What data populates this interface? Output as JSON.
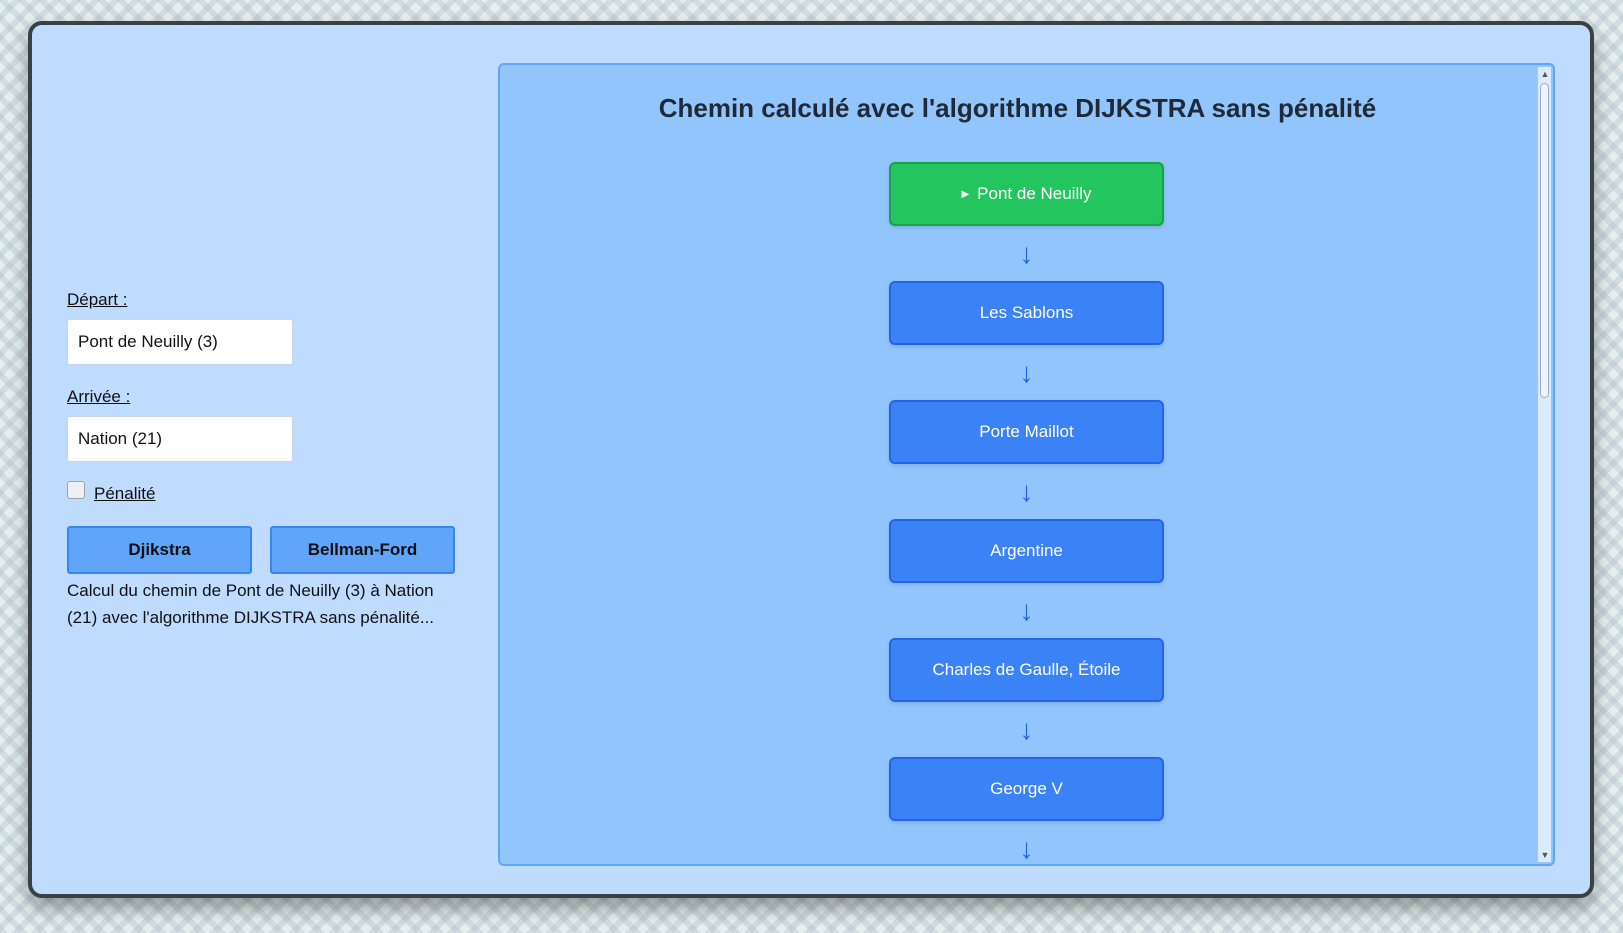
{
  "form": {
    "departure_label": "Départ :",
    "departure_value": "Pont de Neuilly (3)",
    "arrival_label": "Arrivée :",
    "arrival_value": "Nation (21)",
    "penalty_label": "Pénalité",
    "penalty_checked": false,
    "buttons": {
      "dijkstra": "Djikstra",
      "bellman_ford": "Bellman-Ford"
    },
    "status": "Calcul du chemin de Pont de Neuilly (3) à Nation (21) avec l'algorithme DIJKSTRA sans pénalité..."
  },
  "result": {
    "title": "Chemin calculé avec l'algorithme DIJKSTRA sans pénalité",
    "start_icon": "play-icon",
    "arrow_glyph": "↓",
    "stations": [
      "Pont de Neuilly",
      "Les Sablons",
      "Porte Maillot",
      "Argentine",
      "Charles de Gaulle, Étoile",
      "George V"
    ]
  },
  "colors": {
    "start_station": "#22c55e",
    "station": "#3b82f6",
    "panel": "#93c5fd",
    "window": "#bfdbfe",
    "arrow": "#2563eb"
  }
}
